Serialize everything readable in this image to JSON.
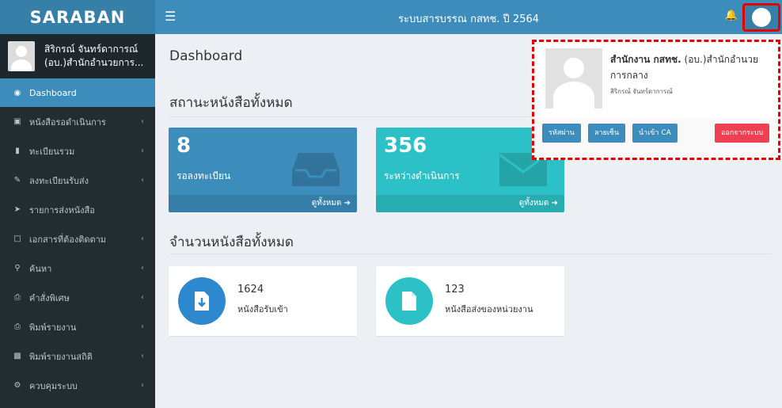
{
  "brand": "SARABAN",
  "user": {
    "name_line1": "สิริกรณ์ จันทร์ดาการณ์",
    "name_line2": "(อบ.)สำนักอำนวยการ..."
  },
  "topbar": {
    "title": "ระบบสารบรรณ กสทช. ปี 2564"
  },
  "sidebar": {
    "items": [
      {
        "label": "Dashboard",
        "icon": "dashboard-icon",
        "active": true
      },
      {
        "label": "หนังสือรอดำเนินการ",
        "icon": "inbox-icon",
        "chevron": true
      },
      {
        "label": "ทะเบียนรวม",
        "icon": "book-icon",
        "chevron": true
      },
      {
        "label": "ลงทะเบียนรับส่ง",
        "icon": "edit-icon",
        "chevron": true
      },
      {
        "label": "รายการส่งหนังสือ",
        "icon": "send-icon"
      },
      {
        "label": "เอกสารที่ต้องติดตาม",
        "icon": "bookmark-icon",
        "chevron": true
      },
      {
        "label": "ค้นหา",
        "icon": "search-icon",
        "chevron": true
      },
      {
        "label": "คำสั่งพิเศษ",
        "icon": "print-icon",
        "chevron": true
      },
      {
        "label": "พิมพ์รายงาน",
        "icon": "print-icon",
        "chevron": true
      },
      {
        "label": "พิมพ์รายงานสถิติ",
        "icon": "bar-chart-icon",
        "chevron": true
      },
      {
        "label": "ควบคุมระบบ",
        "icon": "gear-icon",
        "chevron": true
      }
    ]
  },
  "main": {
    "page_title": "Dashboard",
    "section1_title": "สถานะหนังสือทั้งหมด",
    "stat_boxes": [
      {
        "number": "8",
        "label": "รอลงทะเบียน",
        "link": "ดูทั้งหมด",
        "color": "#3c8dbc"
      },
      {
        "number": "356",
        "label": "ระหว่างดำเนินการ",
        "link": "ดูทั้งหมด",
        "color": "#00c0ef"
      }
    ],
    "section2_title": "จำนวนหนังสือทั้งหมด",
    "info_boxes": [
      {
        "number": "1624",
        "label": "หนังสือรับเข้า",
        "color": "#3c8dbc"
      },
      {
        "number": "123",
        "label": "หนังสือส่งของหน่วยงาน",
        "color": "#00c0ef"
      }
    ]
  },
  "dropdown": {
    "name_bold": "สำนักงาน กสทช.",
    "name_rest": " (อบ.)สำนักอำนวยการกลาง",
    "subtext": "สิริกรณ์ จันทร์ดาการณ์",
    "buttons": {
      "change_password": "รหัสผ่าน",
      "signature": "ลายเซ็น",
      "import_ca": "นำเข้า CA",
      "logout": "ออกจากระบบ"
    }
  }
}
